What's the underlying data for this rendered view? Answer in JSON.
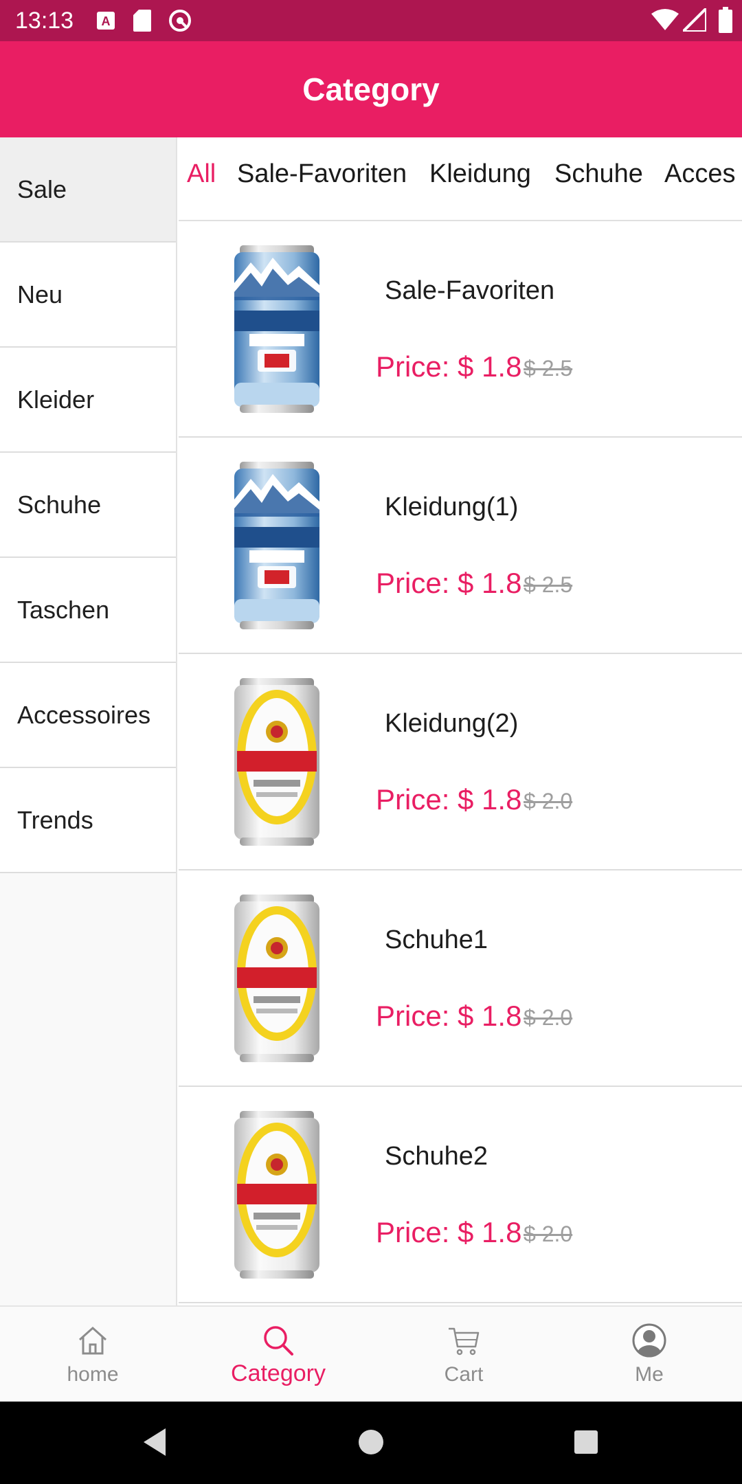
{
  "status_bar": {
    "time": "13:13",
    "left_icons": [
      "text-a-icon",
      "sd-card-icon",
      "sync-circle-icon"
    ],
    "right_icons": [
      "wifi-icon",
      "signal-icon",
      "battery-icon"
    ],
    "color": "#ad1650"
  },
  "app_bar": {
    "title": "Category",
    "color": "#e91e63"
  },
  "sidebar": {
    "items": [
      {
        "label": "Sale",
        "active": true
      },
      {
        "label": "Neu"
      },
      {
        "label": "Kleider"
      },
      {
        "label": "Schuhe"
      },
      {
        "label": "Taschen"
      },
      {
        "label": "Accessoires"
      },
      {
        "label": "Trends"
      }
    ]
  },
  "tabs": [
    {
      "label": "All",
      "active": true
    },
    {
      "label": "Sale-Favoriten"
    },
    {
      "label": "Kleidung"
    },
    {
      "label": "Schuhe"
    },
    {
      "label": "Acces"
    }
  ],
  "products": [
    {
      "name": "Sale-Favoriten",
      "price": "Price: $ 1.8",
      "old_price": "$ 2.5",
      "image": "harbin-beer-can"
    },
    {
      "name": "Kleidung(1)",
      "price": "Price: $ 1.8",
      "old_price": "$ 2.5",
      "image": "harbin-beer-can"
    },
    {
      "name": "Kleidung(2)",
      "price": "Price: $ 1.8",
      "old_price": "$ 2.0",
      "image": "yanjing-beer-can"
    },
    {
      "name": "Schuhe1",
      "price": "Price: $ 1.8",
      "old_price": "$ 2.0",
      "image": "yanjing-beer-can"
    },
    {
      "name": "Schuhe2",
      "price": "Price: $ 1.8",
      "old_price": "$ 2.0",
      "image": "yanjing-beer-can"
    }
  ],
  "bottom_nav": [
    {
      "label": "home",
      "icon": "home-icon"
    },
    {
      "label": "Category",
      "icon": "search-icon",
      "active": true
    },
    {
      "label": "Cart",
      "icon": "cart-icon"
    },
    {
      "label": "Me",
      "icon": "person-icon"
    }
  ],
  "system_nav": [
    "back-icon",
    "home-circle-icon",
    "recents-icon"
  ],
  "accent_color": "#e91e63"
}
